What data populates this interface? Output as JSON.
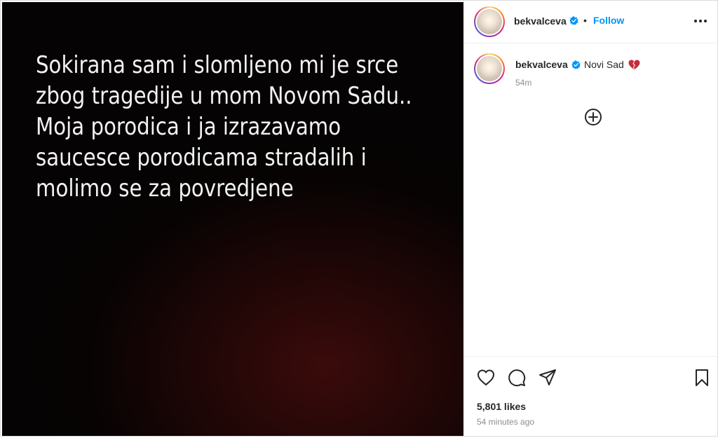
{
  "post": {
    "media_lines": [
      "Sokirana sam i slomljeno mi je srce",
      "zbog tragedije u mom Novom Sadu..",
      "Moja porodica i ja izrazavamo",
      "saucesce porodicama stradalih i",
      "molimo se za povredjene"
    ]
  },
  "header": {
    "username": "bekvalceva",
    "separator": "•",
    "follow_label": "Follow",
    "more_icon": "more-options-icon"
  },
  "caption": {
    "username": "bekvalceva",
    "text": "Novi Sad",
    "emoji_icon": "broken-heart-icon",
    "time": "54m"
  },
  "actions": {
    "like_icon": "heart-icon",
    "comment_icon": "comment-icon",
    "share_icon": "send-icon",
    "save_icon": "bookmark-icon",
    "likes": "5,801 likes",
    "time_ago": "54 minutes ago"
  },
  "colors": {
    "accent": "#0095f6",
    "verified": "#0095f6",
    "text": "#262626",
    "muted": "#8e8e8e"
  }
}
